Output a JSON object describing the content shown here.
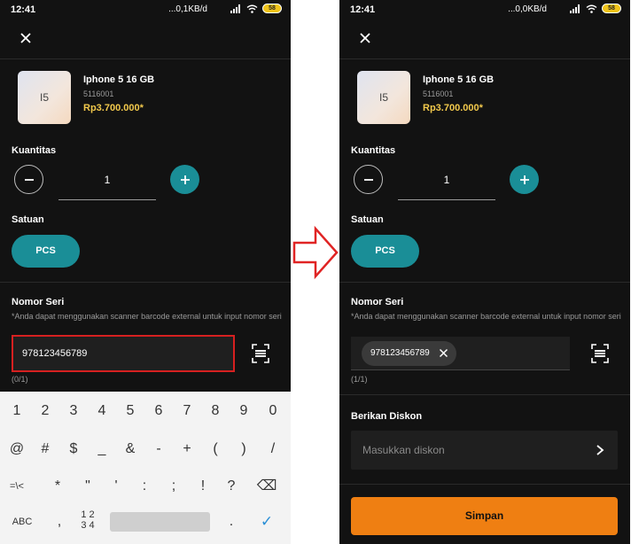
{
  "left": {
    "status": {
      "time": "12:41",
      "speed": "...0,1KB/d",
      "battery": "58"
    },
    "product": {
      "thumb": "I5",
      "name": "Iphone 5 16 GB",
      "sku": "5116001",
      "price": "Rp3.700.000*"
    },
    "quantity": {
      "label": "Kuantitas",
      "value": "1"
    },
    "unit": {
      "label": "Satuan",
      "chip": "PCS"
    },
    "serial": {
      "label": "Nomor Seri",
      "hint": "*Anda dapat menggunakan scanner barcode external untuk input nomor seri",
      "value": "978123456789",
      "count": "(0/1)"
    },
    "keyboard": {
      "row1": [
        "1",
        "2",
        "3",
        "4",
        "5",
        "6",
        "7",
        "8",
        "9",
        "0"
      ],
      "row2": [
        "@",
        "#",
        "$",
        "_",
        "&",
        "-",
        "+",
        "(",
        ")",
        "/"
      ],
      "row3": [
        "=\\<",
        "*",
        "\"",
        "'",
        ":",
        ";",
        "!",
        "?",
        "⌫"
      ],
      "row4": {
        "abc": "ABC",
        "comma": ",",
        "nums": "1 2\n3 4",
        "dot": ".",
        "enter": "✓"
      }
    }
  },
  "right": {
    "status": {
      "time": "12:41",
      "speed": "...0,0KB/d",
      "battery": "58"
    },
    "product": {
      "thumb": "I5",
      "name": "Iphone 5 16 GB",
      "sku": "5116001",
      "price": "Rp3.700.000*"
    },
    "quantity": {
      "label": "Kuantitas",
      "value": "1"
    },
    "unit": {
      "label": "Satuan",
      "chip": "PCS"
    },
    "serial": {
      "label": "Nomor Seri",
      "hint": "*Anda dapat menggunakan scanner barcode external untuk input nomor seri",
      "chip": "978123456789",
      "count": "(1/1)"
    },
    "discount": {
      "label": "Berikan Diskon",
      "placeholder": "Masukkan diskon"
    },
    "save": "Simpan"
  },
  "colors": {
    "accent": "#1a8e97",
    "price": "#f2c94c",
    "highlight": "#d62020",
    "save": "#ef7f12",
    "background": "#121212"
  },
  "icons": [
    "close-icon",
    "minus-icon",
    "plus-icon",
    "barcode-scan-icon",
    "chip-remove-icon",
    "chevron-right-icon",
    "right-arrow-icon",
    "wifi-icon",
    "signal-icon",
    "battery-icon"
  ]
}
